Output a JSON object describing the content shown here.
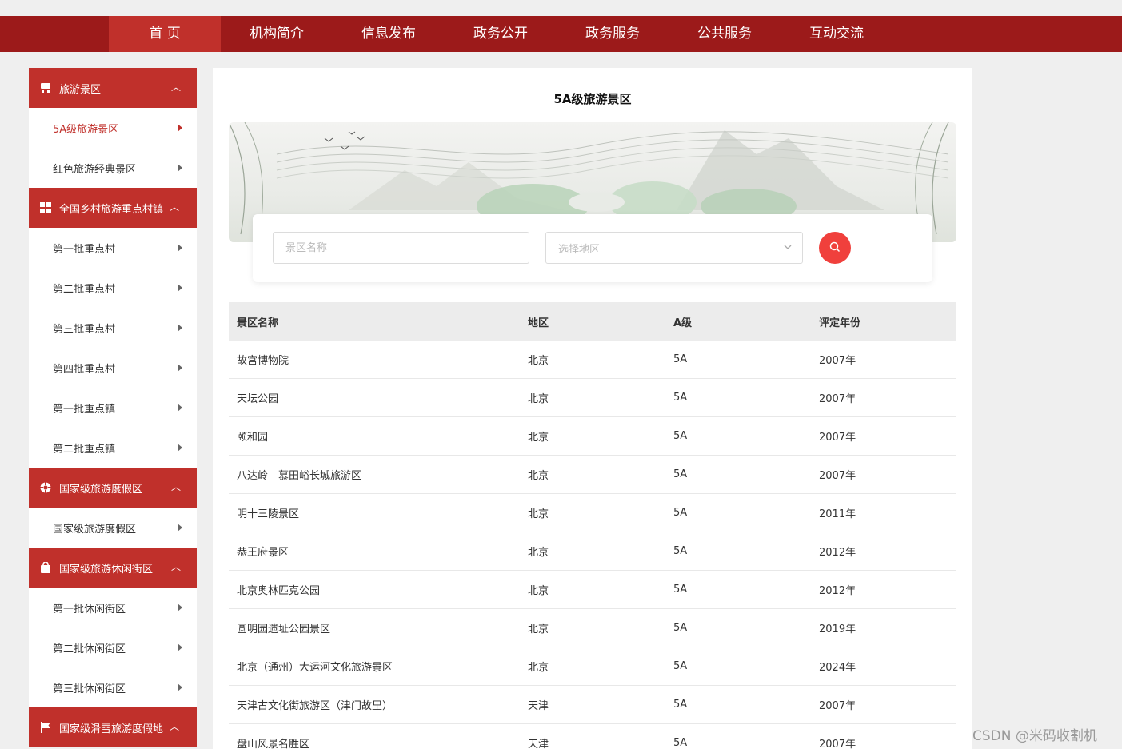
{
  "nav": {
    "items": [
      "首 页",
      "机构简介",
      "信息发布",
      "政务公开",
      "政务服务",
      "公共服务",
      "互动交流"
    ],
    "active_index": 0
  },
  "sidebar": {
    "groups": [
      {
        "title": "旅游景区",
        "icon": "store-icon",
        "items": [
          "5A级旅游景区",
          "红色旅游经典景区"
        ]
      },
      {
        "title": "全国乡村旅游重点村镇",
        "icon": "grid-icon",
        "items": [
          "第一批重点村",
          "第二批重点村",
          "第三批重点村",
          "第四批重点村",
          "第一批重点镇",
          "第二批重点镇"
        ]
      },
      {
        "title": "国家级旅游度假区",
        "icon": "lifebuoy-icon",
        "items": [
          "国家级旅游度假区"
        ]
      },
      {
        "title": "国家级旅游休闲街区",
        "icon": "shopping-bag-icon",
        "items": [
          "第一批休闲街区",
          "第二批休闲街区",
          "第三批休闲街区"
        ]
      },
      {
        "title": "国家级滑雪旅游度假地",
        "icon": "flag-icon",
        "items": []
      }
    ],
    "active_item": "5A级旅游景区"
  },
  "main": {
    "title": "5A级旅游景区",
    "search": {
      "name_placeholder": "景区名称",
      "region_placeholder": "选择地区"
    },
    "table": {
      "headers": [
        "景区名称",
        "地区",
        "A级",
        "评定年份"
      ],
      "rows": [
        [
          "故宫博物院",
          "北京",
          "5A",
          "2007年"
        ],
        [
          "天坛公园",
          "北京",
          "5A",
          "2007年"
        ],
        [
          "颐和园",
          "北京",
          "5A",
          "2007年"
        ],
        [
          "八达岭—慕田峪长城旅游区",
          "北京",
          "5A",
          "2007年"
        ],
        [
          "明十三陵景区",
          "北京",
          "5A",
          "2011年"
        ],
        [
          "恭王府景区",
          "北京",
          "5A",
          "2012年"
        ],
        [
          "北京奥林匹克公园",
          "北京",
          "5A",
          "2012年"
        ],
        [
          "圆明园遗址公园景区",
          "北京",
          "5A",
          "2019年"
        ],
        [
          "北京（通州）大运河文化旅游景区",
          "北京",
          "5A",
          "2024年"
        ],
        [
          "天津古文化街旅游区（津门故里）",
          "天津",
          "5A",
          "2007年"
        ],
        [
          "盘山风景名胜区",
          "天津",
          "5A",
          "2007年"
        ]
      ]
    }
  },
  "watermark": "CSDN @米码收割机",
  "colors": {
    "nav_bg": "#9c1a1a",
    "accent": "#c0302b",
    "search_button": "#f0403c"
  }
}
